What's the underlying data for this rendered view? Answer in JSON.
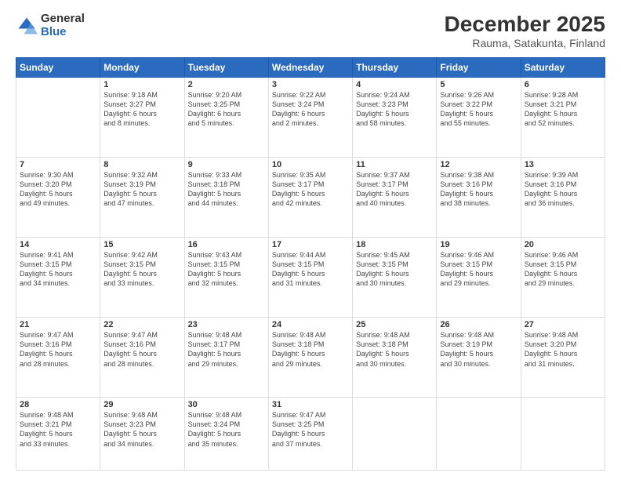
{
  "logo": {
    "general": "General",
    "blue": "Blue"
  },
  "title": "December 2025",
  "subtitle": "Rauma, Satakunta, Finland",
  "weekdays": [
    "Sunday",
    "Monday",
    "Tuesday",
    "Wednesday",
    "Thursday",
    "Friday",
    "Saturday"
  ],
  "weeks": [
    [
      {
        "num": "",
        "info": ""
      },
      {
        "num": "1",
        "info": "Sunrise: 9:18 AM\nSunset: 3:27 PM\nDaylight: 6 hours\nand 8 minutes."
      },
      {
        "num": "2",
        "info": "Sunrise: 9:20 AM\nSunset: 3:25 PM\nDaylight: 6 hours\nand 5 minutes."
      },
      {
        "num": "3",
        "info": "Sunrise: 9:22 AM\nSunset: 3:24 PM\nDaylight: 6 hours\nand 2 minutes."
      },
      {
        "num": "4",
        "info": "Sunrise: 9:24 AM\nSunset: 3:23 PM\nDaylight: 5 hours\nand 58 minutes."
      },
      {
        "num": "5",
        "info": "Sunrise: 9:26 AM\nSunset: 3:22 PM\nDaylight: 5 hours\nand 55 minutes."
      },
      {
        "num": "6",
        "info": "Sunrise: 9:28 AM\nSunset: 3:21 PM\nDaylight: 5 hours\nand 52 minutes."
      }
    ],
    [
      {
        "num": "7",
        "info": "Sunrise: 9:30 AM\nSunset: 3:20 PM\nDaylight: 5 hours\nand 49 minutes."
      },
      {
        "num": "8",
        "info": "Sunrise: 9:32 AM\nSunset: 3:19 PM\nDaylight: 5 hours\nand 47 minutes."
      },
      {
        "num": "9",
        "info": "Sunrise: 9:33 AM\nSunset: 3:18 PM\nDaylight: 5 hours\nand 44 minutes."
      },
      {
        "num": "10",
        "info": "Sunrise: 9:35 AM\nSunset: 3:17 PM\nDaylight: 5 hours\nand 42 minutes."
      },
      {
        "num": "11",
        "info": "Sunrise: 9:37 AM\nSunset: 3:17 PM\nDaylight: 5 hours\nand 40 minutes."
      },
      {
        "num": "12",
        "info": "Sunrise: 9:38 AM\nSunset: 3:16 PM\nDaylight: 5 hours\nand 38 minutes."
      },
      {
        "num": "13",
        "info": "Sunrise: 9:39 AM\nSunset: 3:16 PM\nDaylight: 5 hours\nand 36 minutes."
      }
    ],
    [
      {
        "num": "14",
        "info": "Sunrise: 9:41 AM\nSunset: 3:15 PM\nDaylight: 5 hours\nand 34 minutes."
      },
      {
        "num": "15",
        "info": "Sunrise: 9:42 AM\nSunset: 3:15 PM\nDaylight: 5 hours\nand 33 minutes."
      },
      {
        "num": "16",
        "info": "Sunrise: 9:43 AM\nSunset: 3:15 PM\nDaylight: 5 hours\nand 32 minutes."
      },
      {
        "num": "17",
        "info": "Sunrise: 9:44 AM\nSunset: 3:15 PM\nDaylight: 5 hours\nand 31 minutes."
      },
      {
        "num": "18",
        "info": "Sunrise: 9:45 AM\nSunset: 3:15 PM\nDaylight: 5 hours\nand 30 minutes."
      },
      {
        "num": "19",
        "info": "Sunrise: 9:46 AM\nSunset: 3:15 PM\nDaylight: 5 hours\nand 29 minutes."
      },
      {
        "num": "20",
        "info": "Sunrise: 9:46 AM\nSunset: 3:15 PM\nDaylight: 5 hours\nand 29 minutes."
      }
    ],
    [
      {
        "num": "21",
        "info": "Sunrise: 9:47 AM\nSunset: 3:16 PM\nDaylight: 5 hours\nand 28 minutes."
      },
      {
        "num": "22",
        "info": "Sunrise: 9:47 AM\nSunset: 3:16 PM\nDaylight: 5 hours\nand 28 minutes."
      },
      {
        "num": "23",
        "info": "Sunrise: 9:48 AM\nSunset: 3:17 PM\nDaylight: 5 hours\nand 29 minutes."
      },
      {
        "num": "24",
        "info": "Sunrise: 9:48 AM\nSunset: 3:18 PM\nDaylight: 5 hours\nand 29 minutes."
      },
      {
        "num": "25",
        "info": "Sunrise: 9:48 AM\nSunset: 3:18 PM\nDaylight: 5 hours\nand 30 minutes."
      },
      {
        "num": "26",
        "info": "Sunrise: 9:48 AM\nSunset: 3:19 PM\nDaylight: 5 hours\nand 30 minutes."
      },
      {
        "num": "27",
        "info": "Sunrise: 9:48 AM\nSunset: 3:20 PM\nDaylight: 5 hours\nand 31 minutes."
      }
    ],
    [
      {
        "num": "28",
        "info": "Sunrise: 9:48 AM\nSunset: 3:21 PM\nDaylight: 5 hours\nand 33 minutes."
      },
      {
        "num": "29",
        "info": "Sunrise: 9:48 AM\nSunset: 3:23 PM\nDaylight: 5 hours\nand 34 minutes."
      },
      {
        "num": "30",
        "info": "Sunrise: 9:48 AM\nSunset: 3:24 PM\nDaylight: 5 hours\nand 35 minutes."
      },
      {
        "num": "31",
        "info": "Sunrise: 9:47 AM\nSunset: 3:25 PM\nDaylight: 5 hours\nand 37 minutes."
      },
      {
        "num": "",
        "info": ""
      },
      {
        "num": "",
        "info": ""
      },
      {
        "num": "",
        "info": ""
      }
    ]
  ]
}
